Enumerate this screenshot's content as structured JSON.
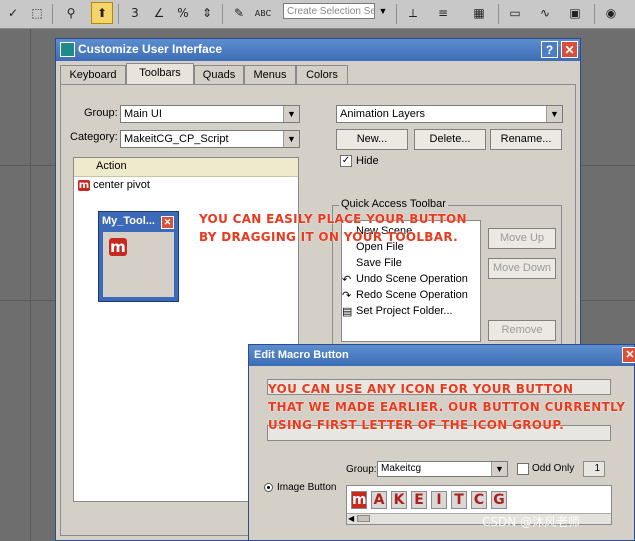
{
  "toolbar": {
    "selection_set_placeholder": "Create Selection Se",
    "items": [
      "select-icon",
      "hierarchy-icon",
      "link-icon",
      "snap-3-icon",
      "angle-snap-icon",
      "percent-snap-icon",
      "spinner-snap-icon",
      "edit-named-selection-icon",
      "mirror-icon",
      "align-icon",
      "layer-icon",
      "curve-editor-icon",
      "schematic-icon",
      "material-editor-icon"
    ],
    "snap_label": "3",
    "abc_label": "ABC"
  },
  "customize_dialog": {
    "title": "Customize User Interface",
    "help_label": "?",
    "close_label": "✕",
    "tabs": [
      {
        "label": "Keyboard",
        "selected": false
      },
      {
        "label": "Toolbars",
        "selected": true
      },
      {
        "label": "Quads",
        "selected": false
      },
      {
        "label": "Menus",
        "selected": false
      },
      {
        "label": "Colors",
        "selected": false
      }
    ],
    "group_label": "Group:",
    "group_value": "Main UI",
    "category_label": "Category:",
    "category_value": "MakeitCG_CP_Script",
    "toolbar_select_value": "Animation Layers",
    "new_button": "New...",
    "delete_button": "Delete...",
    "rename_button": "Rename...",
    "hide_label": "Hide",
    "hide_checked": true,
    "action_header": "Action",
    "action_items": [
      {
        "label": "center pivot",
        "icon": "m-logo-icon"
      }
    ],
    "quick_access_legend": "Quick Access Toolbar",
    "quick_access_items": [
      {
        "label": "New Scene",
        "icon": ""
      },
      {
        "label": "Open File",
        "icon": ""
      },
      {
        "label": "Save File",
        "icon": ""
      },
      {
        "label": "Undo Scene Operation",
        "icon": "undo-icon"
      },
      {
        "label": "Redo Scene Operation",
        "icon": "redo-icon"
      },
      {
        "label": "Set Project Folder...",
        "icon": "folder-icon"
      }
    ],
    "move_up_button": "Move Up",
    "move_down_button": "Move Down",
    "remove_button": "Remove"
  },
  "floating_toolbar": {
    "title": "My_Tool...",
    "button_glyph": "m"
  },
  "edit_macro_dialog": {
    "title": "Edit Macro Button",
    "close_label": "✕",
    "image_button_label": "Image Button",
    "group_label": "Group:",
    "group_value": "Makeitcg",
    "odd_only_label": "Odd Only",
    "odd_count": "1",
    "icon_letters": [
      "m",
      "A",
      "K",
      "E",
      "I",
      "T",
      "C",
      "G"
    ]
  },
  "annotations": {
    "note1": "YOU CAN EASILY PLACE YOUR BUTTON\nBY DRAGGING IT ON YOUR TOOLBAR.",
    "note2": "YOU CAN USE ANY ICON FOR YOUR BUTTON\nTHAT WE MADE EARLIER. OUR BUTTON CURRENTLY\nUSING FIRST LETTER OF THE ICON GROUP."
  },
  "watermark": "CSDN @沐风老师",
  "colors": {
    "annotation": "#e83a1d",
    "titlebar": "#3d6db5",
    "accent_m": "#c8281e"
  }
}
